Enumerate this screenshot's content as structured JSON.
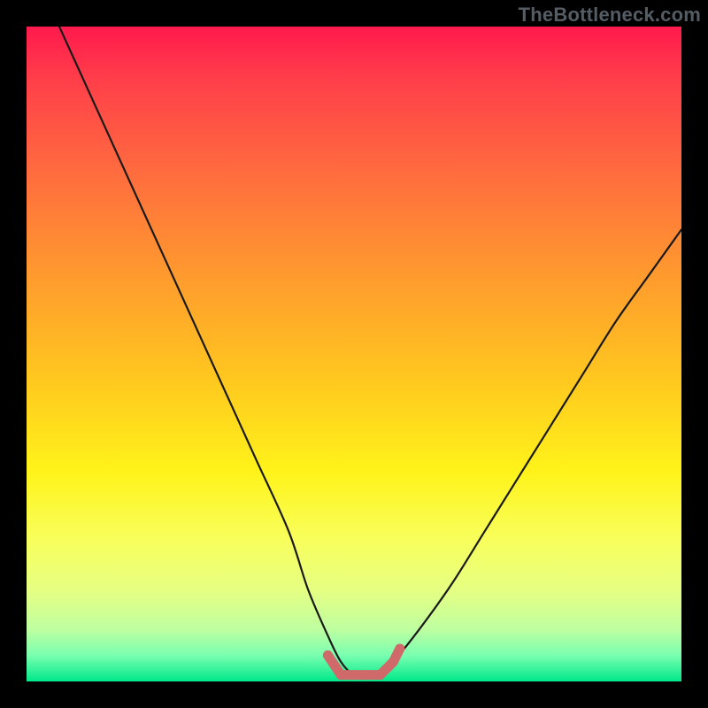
{
  "watermark": "TheBottleneck.com",
  "chart_data": {
    "type": "line",
    "title": "",
    "xlabel": "",
    "ylabel": "",
    "xlim": [
      0,
      100
    ],
    "ylim": [
      0,
      100
    ],
    "series": [
      {
        "name": "bottleneck-curve",
        "x": [
          5,
          10,
          15,
          20,
          25,
          30,
          35,
          40,
          43,
          46,
          48,
          50,
          52,
          54,
          56,
          60,
          65,
          70,
          75,
          80,
          85,
          90,
          95,
          100
        ],
        "y": [
          100,
          89,
          78,
          67,
          56,
          45,
          34,
          23,
          14,
          7,
          3,
          1,
          1,
          1,
          3,
          8,
          15,
          23,
          31,
          39,
          47,
          55,
          62,
          69
        ]
      }
    ],
    "markers": {
      "name": "highlight-dots",
      "color": "#d06a6a",
      "points_x": [
        46,
        48,
        50,
        52,
        54,
        56,
        57
      ],
      "points_y": [
        4,
        1,
        1,
        1,
        1,
        3,
        5
      ]
    }
  }
}
